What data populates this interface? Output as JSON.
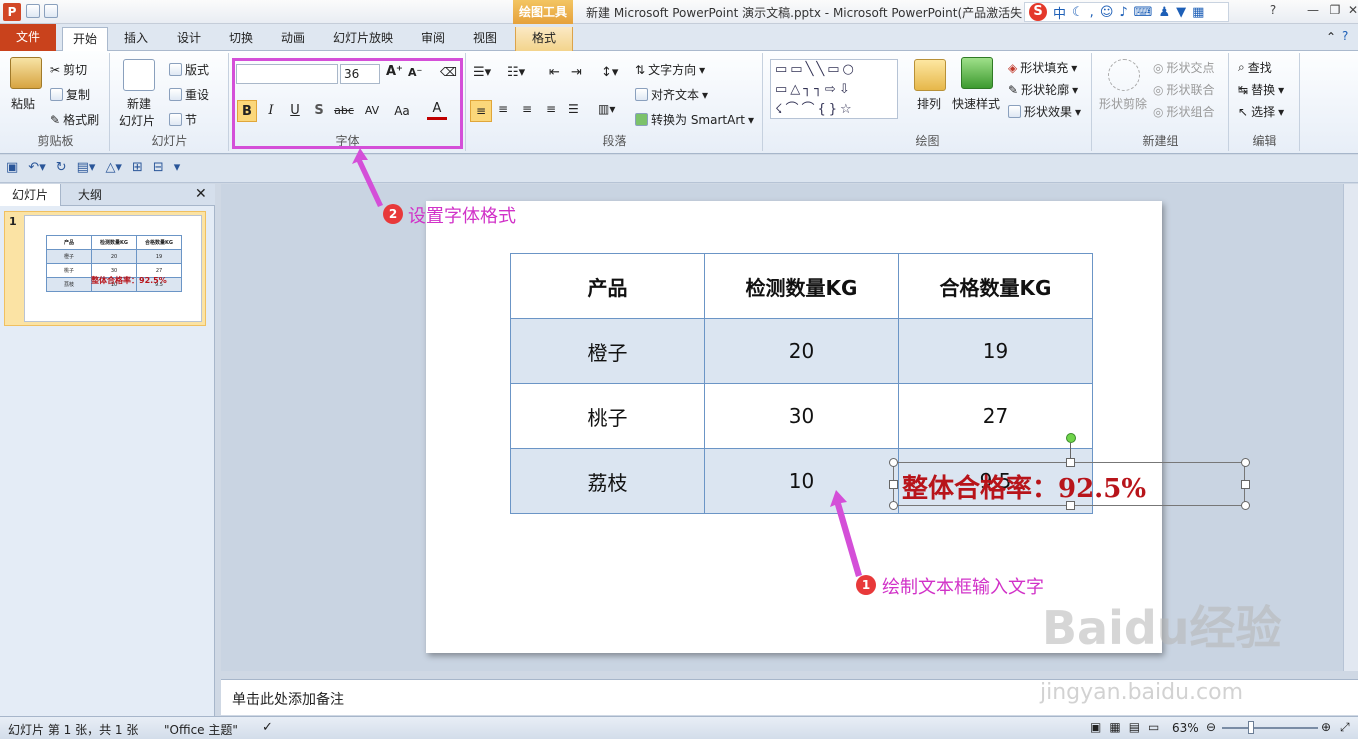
{
  "titlebar": {
    "app_icon": "P",
    "context_tab": "绘图工具",
    "title": "新建 Microsoft PowerPoint 演示文稿.pptx - Microsoft PowerPoint(产品激活失",
    "ime_logo": "S",
    "ime_mode": "中",
    "window_buttons": [
      "?",
      "—",
      "❐",
      "✕"
    ]
  },
  "tabs": {
    "file": "文件",
    "items": [
      "开始",
      "插入",
      "设计",
      "切换",
      "动画",
      "幻灯片放映",
      "审阅",
      "视图"
    ],
    "format": "格式"
  },
  "ribbon": {
    "clipboard": {
      "label": "剪贴板",
      "paste": "粘贴",
      "cut": "剪切",
      "copy": "复制",
      "format_painter": "格式刷"
    },
    "slides": {
      "label": "幻灯片",
      "new_slide_line1": "新建",
      "new_slide_line2": "幻灯片",
      "layout": "版式",
      "reset": "重设",
      "section": "节"
    },
    "font": {
      "label": "字体",
      "size": "36",
      "bold": "B",
      "italic": "I",
      "underline": "U",
      "shadow": "S",
      "strike": "abc",
      "spacing": "AV",
      "case": "Aa",
      "color": "A"
    },
    "paragraph": {
      "label": "段落",
      "text_direction": "文字方向",
      "align_text": "对齐文本",
      "smartart": "转换为 SmartArt"
    },
    "drawing": {
      "label": "绘图",
      "arrange": "排列",
      "quick_styles": "快速样式",
      "fill": "形状填充",
      "outline": "形状轮廓",
      "effects": "形状效果"
    },
    "newgroup": {
      "label": "新建组",
      "subtract": "形状剪除",
      "intersect": "形状交点",
      "union": "形状联合",
      "combine": "形状组合"
    },
    "editing": {
      "label": "编辑",
      "find": "查找",
      "replace": "替换",
      "select": "选择"
    }
  },
  "leftpane": {
    "tab_slides": "幻灯片",
    "tab_outline": "大纲",
    "slide_number": "1"
  },
  "table": {
    "headers": [
      "产品",
      "检测数量KG",
      "合格数量KG"
    ],
    "rows": [
      [
        "橙子",
        "20",
        "19"
      ],
      [
        "桃子",
        "30",
        "27"
      ],
      [
        "荔枝",
        "10",
        "9.5"
      ]
    ]
  },
  "textbox": {
    "text": "整体合格率：92.5%"
  },
  "notes": {
    "placeholder": "单击此处添加备注"
  },
  "status": {
    "slide_info": "幻灯片 第 1 张，共 1 张",
    "theme": "\"Office 主题\"",
    "zoom": "63%"
  },
  "annotations": [
    {
      "number": "2",
      "text": "设置字体格式"
    },
    {
      "number": "1",
      "text": "绘制文本框输入文字"
    }
  ],
  "watermark": {
    "main": "Baidu经验",
    "sub": "jingyan.baidu.com"
  },
  "colors": {
    "accent": "#d44fd8",
    "file_tab": "#c9421c",
    "textbox_text": "#b8141a",
    "table_border": "#6b95c6"
  }
}
